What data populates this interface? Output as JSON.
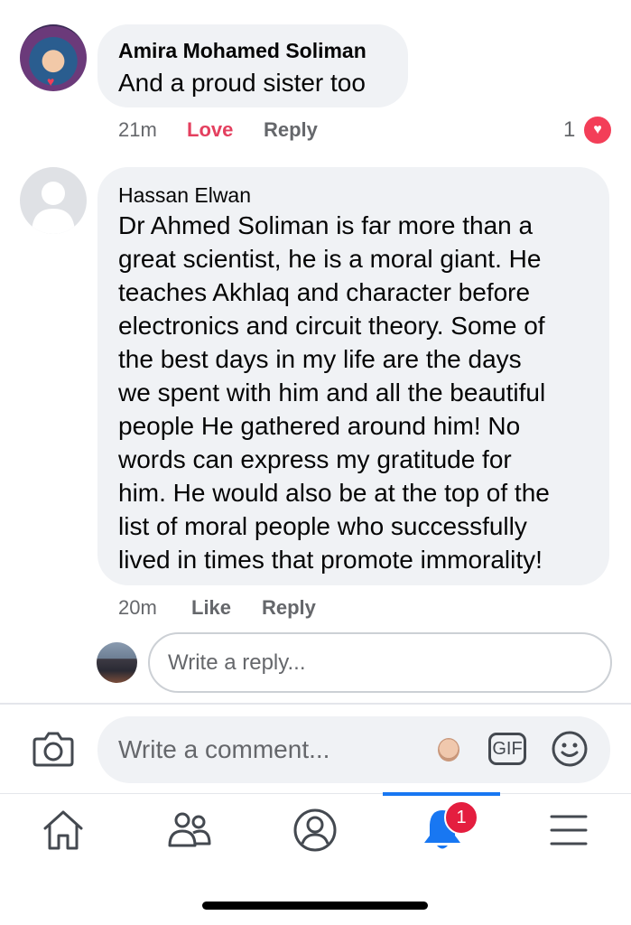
{
  "comments": [
    {
      "author": "Amira Mohamed Soliman",
      "text": "And a proud sister too",
      "time": "21m",
      "react_label": "Love",
      "reply_label": "Reply",
      "reaction_count": "1"
    },
    {
      "author": "Hassan Elwan",
      "lines": [
        "Dr Ahmed Soliman is far more than a",
        "great scientist, he is a moral giant. He",
        "teaches Akhlaq and character before",
        "electronics and circuit theory. Some of",
        "the best days in my life are the days",
        "we spent with him and all the beautiful",
        "people He gathered around him! No",
        "words can express my gratitude for",
        "him. He would also be at the top of the",
        "list of moral people who successfully",
        "lived in times that promote immorality!"
      ],
      "time": "20m",
      "react_label": "Like",
      "reply_label": "Reply"
    }
  ],
  "reply_box": {
    "placeholder": "Write a reply..."
  },
  "comment_box": {
    "placeholder": "Write a comment...",
    "gif_label": "GIF"
  },
  "nav": {
    "items": [
      {
        "name": "home",
        "icon": "home-icon"
      },
      {
        "name": "friends",
        "icon": "friends-icon"
      },
      {
        "name": "profile",
        "icon": "profile-icon"
      },
      {
        "name": "notifications",
        "icon": "bell-icon",
        "badge": "1",
        "active": true
      },
      {
        "name": "menu",
        "icon": "menu-icon"
      }
    ]
  },
  "colors": {
    "accent": "#1877f2",
    "love": "#e4405f",
    "badge": "#e41e3f",
    "bubble": "#f0f2f5",
    "meta": "#65676b"
  }
}
